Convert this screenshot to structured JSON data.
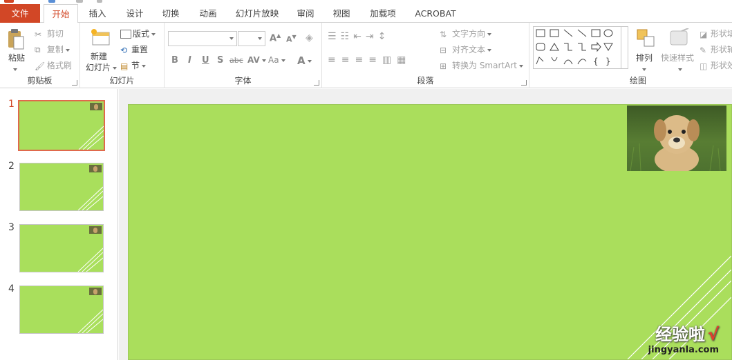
{
  "tabs": {
    "file": "文件",
    "items": [
      "开始",
      "插入",
      "设计",
      "切换",
      "动画",
      "幻灯片放映",
      "审阅",
      "视图",
      "加载项",
      "ACROBAT"
    ]
  },
  "clipboard": {
    "paste": "粘贴",
    "cut": "剪切",
    "copy": "复制",
    "format_painter": "格式刷",
    "label": "剪贴板"
  },
  "slides_group": {
    "new_slide_line1": "新建",
    "new_slide_line2": "幻灯片",
    "layout": "版式",
    "reset": "重置",
    "section": "节",
    "label": "幻灯片"
  },
  "font": {
    "label": "字体",
    "bold": "B",
    "italic": "I",
    "underline": "U",
    "shadow": "S",
    "strike": "abc",
    "spacing": "AV",
    "case": "Aa",
    "grow": "A",
    "shrink": "A",
    "color": "A"
  },
  "paragraph": {
    "label": "段落",
    "text_direction": "文字方向",
    "align_text": "对齐文本",
    "smartart": "转换为 SmartArt"
  },
  "drawing": {
    "label": "绘图",
    "arrange": "排列",
    "quick_styles": "快速样式",
    "shape_fill": "形状填",
    "shape_outline": "形状轮",
    "shape_effects": "形状效"
  },
  "slide_numbers": [
    "1",
    "2",
    "3",
    "4"
  ],
  "watermark": {
    "brand": "经验啦",
    "url": "jingyanla.com",
    "check": "√"
  },
  "colors": {
    "accent": "#d24726",
    "slide_bg": "#aade5c"
  }
}
